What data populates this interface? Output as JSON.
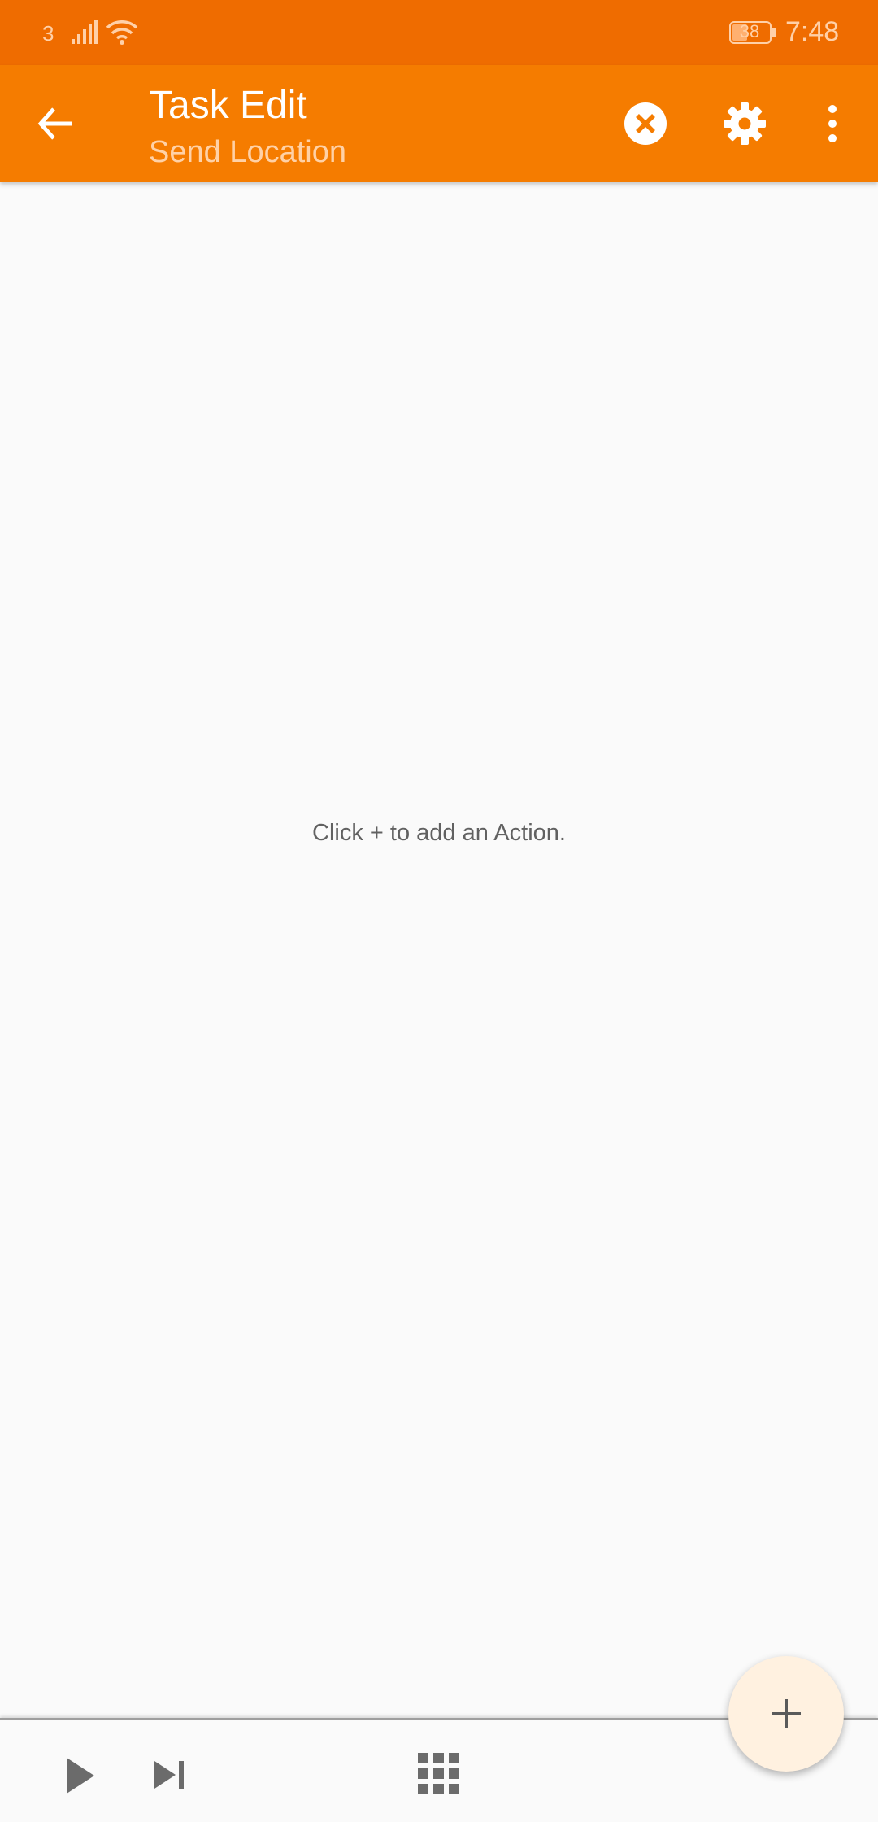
{
  "status_bar": {
    "carrier_label": "3",
    "battery_level": "38",
    "time": "7:48",
    "icons": [
      "signal-icon",
      "wifi-icon",
      "battery-icon"
    ]
  },
  "toolbar": {
    "title": "Task Edit",
    "subtitle": "Send Location",
    "icons": [
      "back-arrow-icon",
      "cancel-icon",
      "gear-icon",
      "more-vert-icon"
    ]
  },
  "content": {
    "empty_hint": "Click + to add an Action."
  },
  "bottom_bar": {
    "icons": [
      "play-icon",
      "skip-next-icon",
      "grid-icon"
    ]
  },
  "fab": {
    "icon": "plus-icon"
  },
  "colors": {
    "status_bar": "#ef6c00",
    "toolbar": "#f57c00",
    "fab_background": "#fff1e0",
    "background": "#fafafa"
  }
}
